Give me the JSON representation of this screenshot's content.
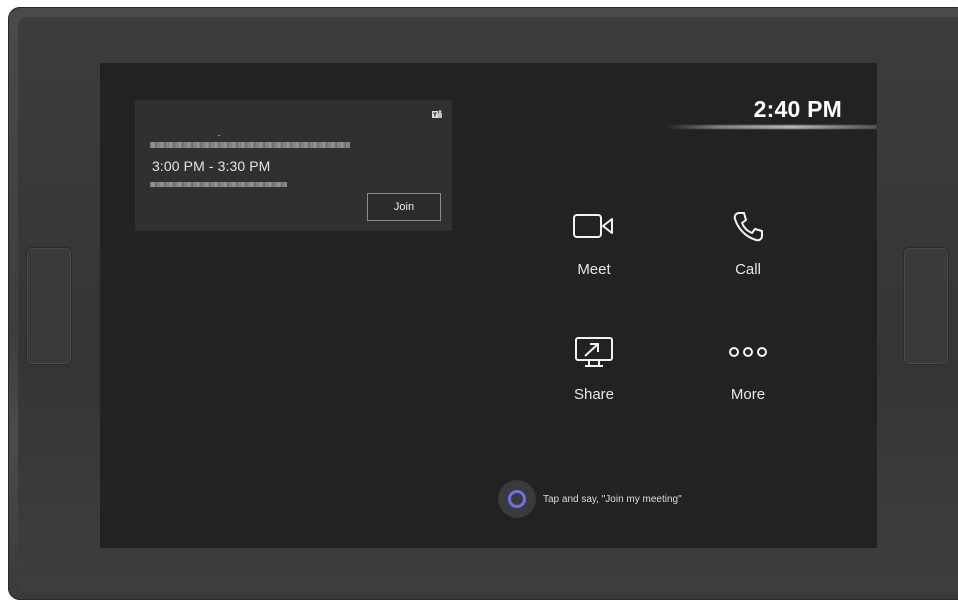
{
  "colors": {
    "screen_background": "#222222",
    "card_background": "#303030",
    "text_primary": "#ffffff",
    "cortana_accent": "#6e72ea"
  },
  "clock": {
    "time": "2:40 PM"
  },
  "meeting_card": {
    "time_range": "3:00 PM - 3:30 PM",
    "join_label": "Join",
    "app_icon": "teams-icon"
  },
  "actions": [
    {
      "label": "Meet",
      "icon": "video-camera-icon"
    },
    {
      "label": "Call",
      "icon": "phone-icon"
    },
    {
      "label": "Share",
      "icon": "screen-share-icon"
    },
    {
      "label": "More",
      "icon": "more-dots-icon"
    }
  ],
  "cortana": {
    "prompt": "Tap and say, \"Join my meeting\"",
    "icon": "cortana-icon"
  }
}
